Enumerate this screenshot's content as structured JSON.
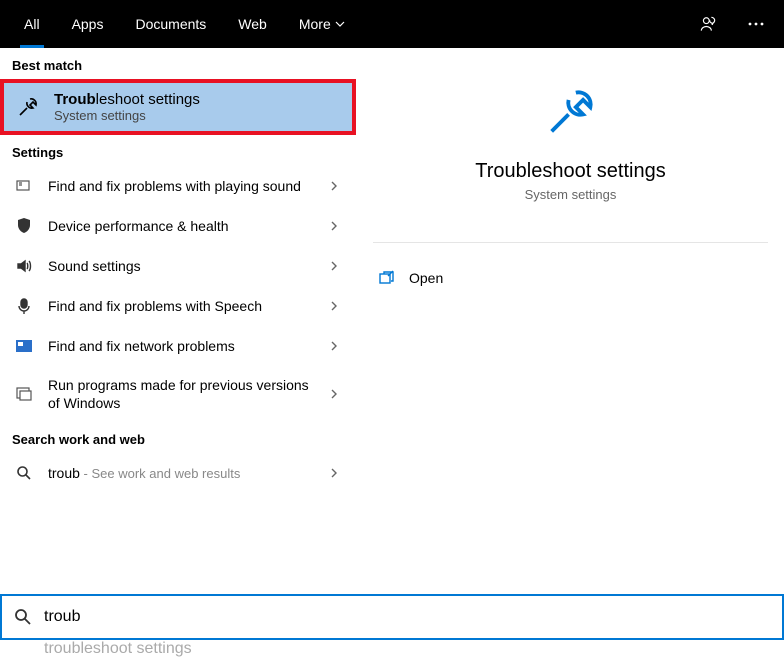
{
  "topbar": {
    "tabs": [
      "All",
      "Apps",
      "Documents",
      "Web",
      "More"
    ],
    "active": 0
  },
  "sections": {
    "best_match": "Best match",
    "settings": "Settings",
    "search_web": "Search work and web"
  },
  "best_match": {
    "title_bold": "Troub",
    "title_rest": "leshoot settings",
    "subtitle": "System settings"
  },
  "settings_items": [
    {
      "label": "Find and fix problems with playing sound"
    },
    {
      "label": "Device performance & health"
    },
    {
      "label": "Sound settings"
    },
    {
      "label": "Find and fix problems with Speech"
    },
    {
      "label": "Find and fix network problems"
    },
    {
      "label": "Run programs made for previous versions of Windows"
    }
  ],
  "web_item": {
    "query": "troub",
    "hint": " - See work and web results"
  },
  "preview": {
    "title": "Troubleshoot settings",
    "subtitle": "System settings",
    "open_label": "Open"
  },
  "search": {
    "typed": "troub",
    "ghost_full": "troubleshoot settings"
  }
}
